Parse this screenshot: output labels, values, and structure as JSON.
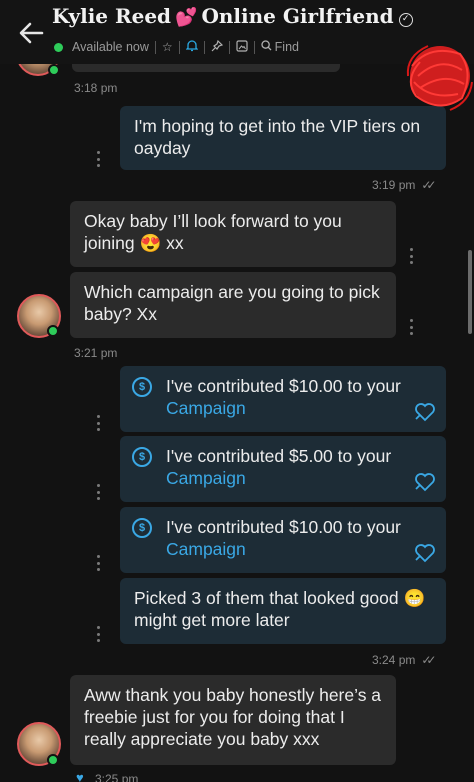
{
  "header": {
    "name": "Kylie Reed",
    "name_suffix": "Online Girlfriend",
    "status": "Available now",
    "find_label": "Find",
    "icons": [
      "back-arrow-icon",
      "star-icon",
      "bell-icon",
      "pin-icon",
      "image-icon",
      "search-icon",
      "verified-icon",
      "heart-emoji"
    ]
  },
  "messages": [
    {
      "time": "3:18 pm"
    },
    {
      "text": "I'm hoping to get into the VIP tiers on oayday",
      "time": "3:19 pm"
    },
    {
      "text": "Okay baby I’ll look forward to you joining 😍 xx"
    },
    {
      "text": "Which campaign are you going to pick baby? Xx",
      "time": "3:21 pm"
    },
    {
      "tip_prefix": "I've contributed $10.00 to your",
      "link": "Campaign"
    },
    {
      "tip_prefix": "I've contributed $5.00 to your",
      "link": "Campaign"
    },
    {
      "tip_prefix": "I've contributed $10.00 to your",
      "link": "Campaign"
    },
    {
      "text": "Picked 3 of them that looked good 😁 might get more later",
      "time": "3:24 pm"
    },
    {
      "text": "Aww thank you baby honestly here’s a freebie just for you for doing that I really appreciate you baby xxx",
      "time": "3:25 pm"
    }
  ],
  "colors": {
    "accent": "#3aa8e5",
    "online": "#2ecc5a",
    "sent_bubble": "#1d2c36",
    "received_bubble": "#2b2b2b",
    "background": "#121212"
  }
}
